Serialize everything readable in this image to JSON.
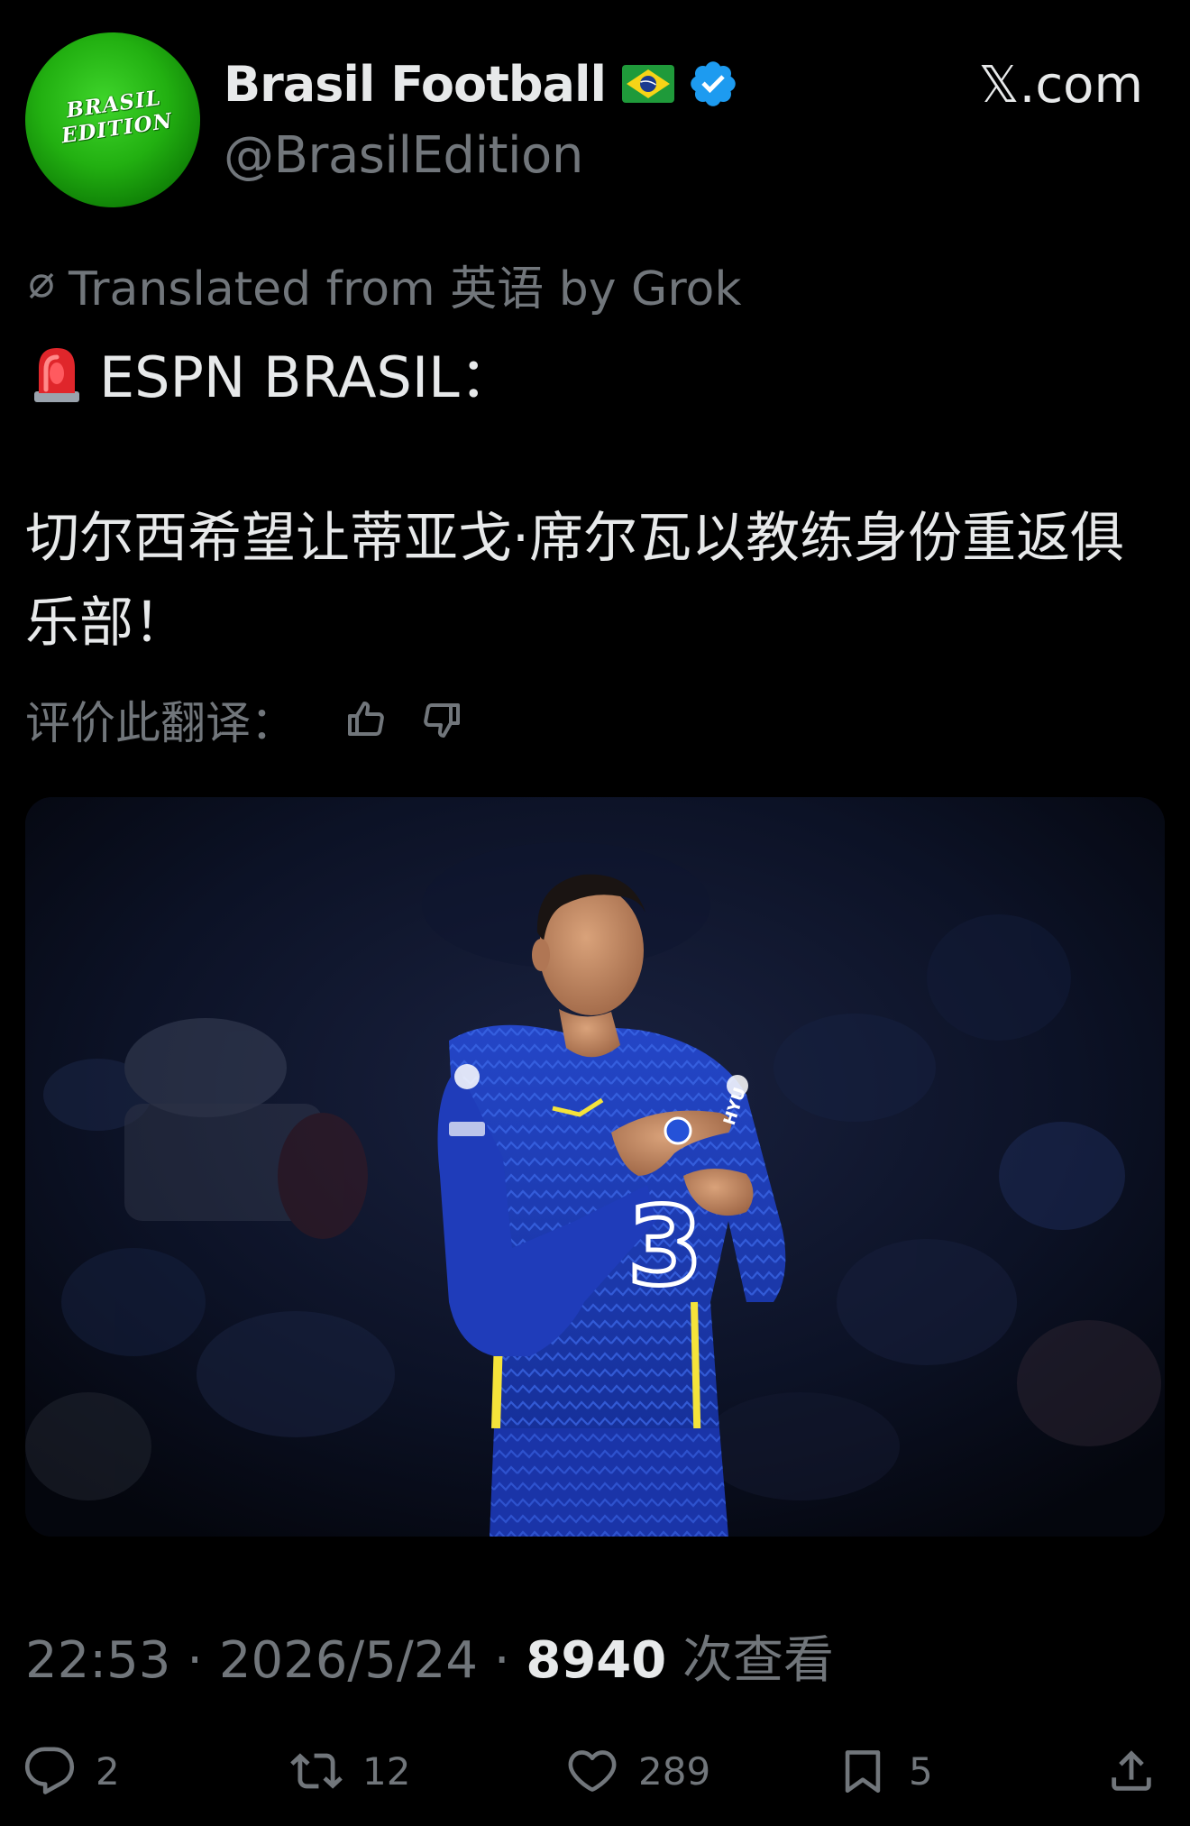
{
  "account": {
    "avatar_text_line1": "BRASIL",
    "avatar_text_line2": "EDITION",
    "display_name": "Brasil Football",
    "handle": "@BrasilEdition",
    "flag": "brazil-flag-icon",
    "verified": "verified-badge-icon"
  },
  "site_label": "𝕏.com",
  "translation": {
    "label": "Translated from 英语 by Grok"
  },
  "tweet": {
    "headline": "ESPN BRASIL：",
    "body": "切尔西希望让蒂亚戈·席尔瓦以教练身份重返俱乐部！"
  },
  "rate": {
    "label": "评价此翻译："
  },
  "meta": {
    "time": "22:53",
    "date": "2026/5/24",
    "separator": "·",
    "views": "8940",
    "views_label": "次查看"
  },
  "actions": {
    "replies": "2",
    "reposts": "12",
    "likes": "289",
    "bookmarks": "5"
  },
  "colors": {
    "background": "#000000",
    "primary_text": "#e7e9ea",
    "secondary_text": "#71767b",
    "verified_blue": "#1d9bf0",
    "avatar_green": "#22b011",
    "kit_blue": "#1e3fb8"
  }
}
